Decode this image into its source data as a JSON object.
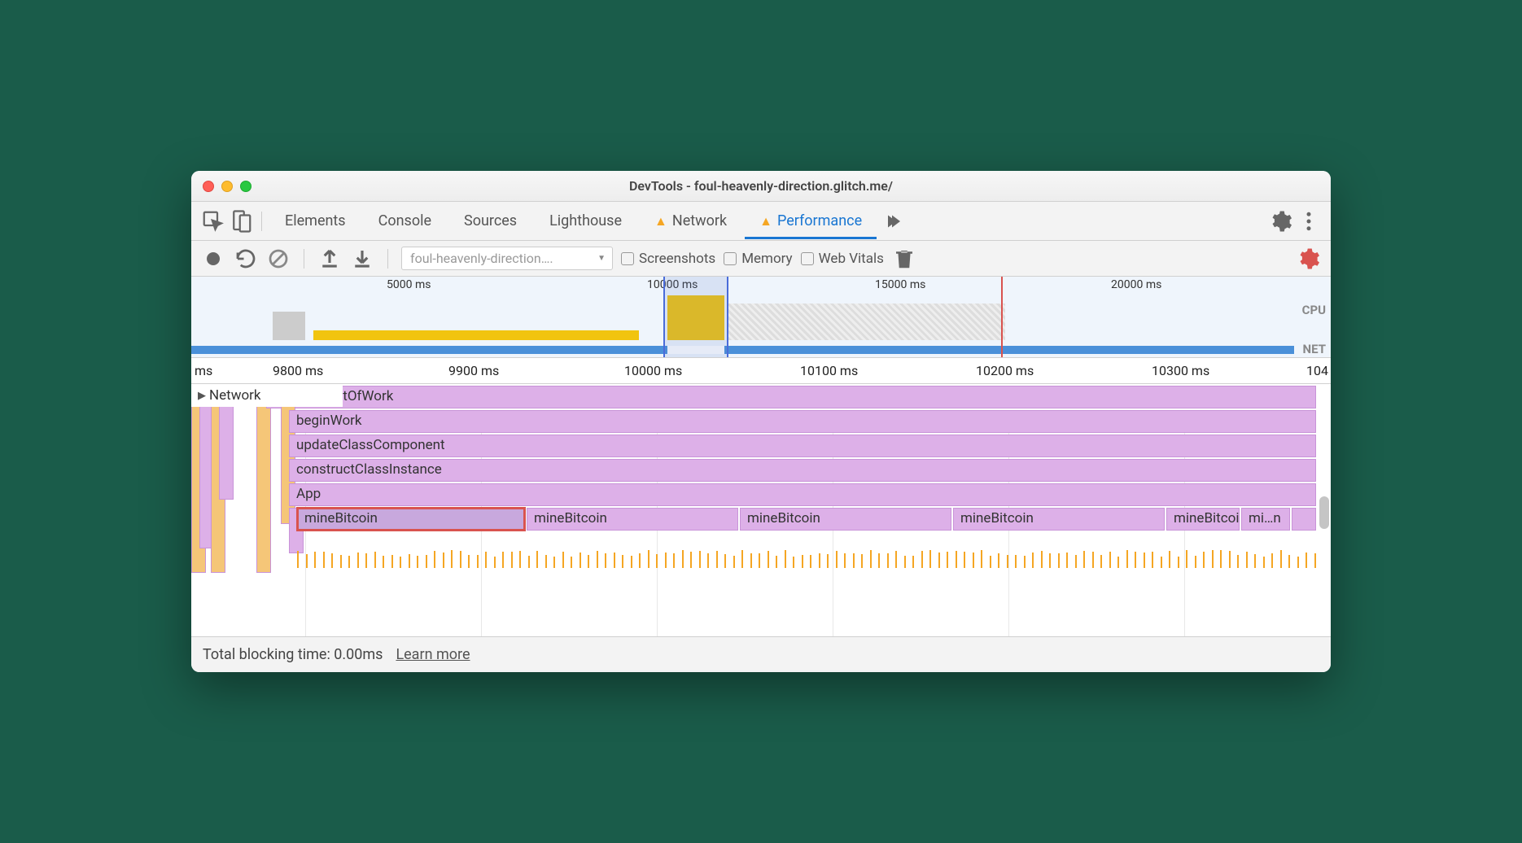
{
  "window": {
    "title": "DevTools - foul-heavenly-direction.glitch.me/"
  },
  "tabs": {
    "elements": "Elements",
    "console": "Console",
    "sources": "Sources",
    "lighthouse": "Lighthouse",
    "network": "Network",
    "performance": "Performance"
  },
  "toolbar": {
    "dropdown": "foul-heavenly-direction….",
    "screenshots": "Screenshots",
    "memory": "Memory",
    "webvitals": "Web Vitals"
  },
  "overview": {
    "ticks": [
      "5000 ms",
      "10000 ms",
      "15000 ms",
      "20000 ms"
    ],
    "cpu_label": "CPU",
    "net_label": "NET"
  },
  "ruler": {
    "ticks": [
      "ms",
      "9800 ms",
      "9900 ms",
      "10000 ms",
      "10100 ms",
      "10200 ms",
      "10300 ms",
      "104"
    ]
  },
  "content": {
    "network_header": "Network",
    "frames": {
      "performUnitOfWork": "performUnitOfWork",
      "beginWork": "beginWork",
      "updateClassComponent": "updateClassComponent",
      "constructClassInstance": "constructClassInstance",
      "app": "App",
      "mineBitcoin": "mineBitcoin",
      "mi_n": "mi…n"
    }
  },
  "footer": {
    "tbt": "Total blocking time: 0.00ms",
    "learn": "Learn more"
  }
}
